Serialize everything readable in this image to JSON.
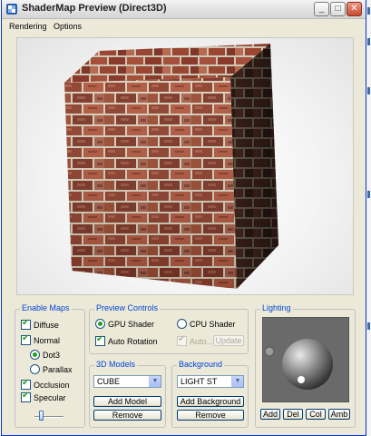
{
  "window": {
    "title": "ShaderMap Preview (Direct3D)",
    "buttons": {
      "minimize": "_",
      "maximize": "□",
      "close": "✕"
    },
    "icon": "shadermap-app-icon"
  },
  "menu": {
    "items": [
      "Rendering",
      "Options"
    ]
  },
  "viewport": {
    "object": "cube",
    "texture": "red-brick",
    "icon": "brick-cube-preview"
  },
  "enable_maps": {
    "title": "Enable Maps",
    "diffuse": {
      "label": "Diffuse",
      "checked": true
    },
    "normal": {
      "label": "Normal",
      "checked": true
    },
    "dot3": {
      "label": "Dot3",
      "selected": true
    },
    "parallax": {
      "label": "Parallax",
      "selected": false
    },
    "occlusion": {
      "label": "Occlusion",
      "checked": true
    },
    "specular": {
      "label": "Specular",
      "checked": true
    },
    "slider": {
      "value_fraction": 0.2
    }
  },
  "preview_controls": {
    "title": "Preview Controls",
    "gpu_shader": {
      "label": "GPU Shader",
      "selected": true
    },
    "cpu_shader": {
      "label": "CPU Shader",
      "selected": false
    },
    "auto_rotation": {
      "label": "Auto Rotation",
      "checked": true
    },
    "auto": {
      "label": "Auto...",
      "checked": true,
      "enabled": false
    },
    "update_label": "Update"
  },
  "models_3d": {
    "title": "3D Models",
    "selected": "CUBE",
    "add_label": "Add Model",
    "remove_label": "Remove"
  },
  "background": {
    "title": "Background",
    "selected": "LIGHT ST",
    "add_label": "Add Background",
    "remove_label": "Remove"
  },
  "lighting": {
    "title": "Lighting",
    "buttons": {
      "add": "Add",
      "del": "Del",
      "col": "Col",
      "amb": "Amb"
    }
  },
  "colors": {
    "accent": "#0046d5",
    "check": "#21a121",
    "frame": "#ece9d8",
    "mortar": "#cfc7b6"
  }
}
